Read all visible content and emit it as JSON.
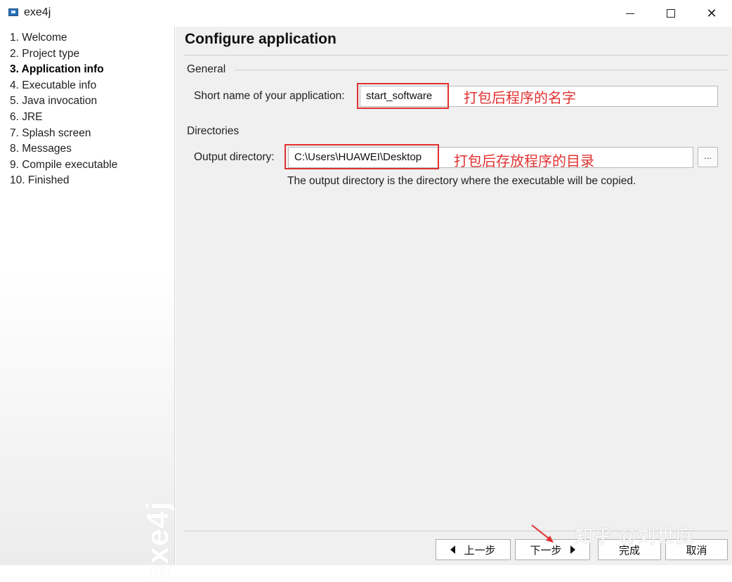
{
  "window": {
    "title": "exe4j",
    "minimize_glyph": "",
    "maximize_glyph": "",
    "close_glyph": "✕"
  },
  "sidebar": {
    "steps": [
      {
        "label": "1. Welcome"
      },
      {
        "label": "2. Project type"
      },
      {
        "label": "3. Application info",
        "active": true
      },
      {
        "label": "4. Executable info"
      },
      {
        "label": "5. Java invocation"
      },
      {
        "label": "6. JRE"
      },
      {
        "label": "7. Splash screen"
      },
      {
        "label": "8. Messages"
      },
      {
        "label": "9. Compile executable"
      },
      {
        "label": "10. Finished"
      }
    ],
    "watermark": "exe4j"
  },
  "main": {
    "title": "Configure application",
    "general": {
      "heading": "General",
      "short_name_label": "Short name of your application:",
      "short_name_value": "start_software",
      "short_name_annotation": "打包后程序的名字"
    },
    "directories": {
      "heading": "Directories",
      "output_label": "Output directory:",
      "output_value": "C:\\Users\\HUAWEI\\Desktop",
      "output_annotation": "打包后存放程序的目录",
      "browse_label": "...",
      "helper_text": "The output directory is the directory where the executable will be copied."
    }
  },
  "footer": {
    "back_label": "上一步",
    "next_label": "下一步",
    "finish_label": "完成",
    "cancel_label": "取消"
  },
  "overlay": {
    "watermark": "知乎 @刘世庭"
  },
  "colors": {
    "annotation": "#e03131",
    "panel_bg": "#f0f0f0"
  }
}
